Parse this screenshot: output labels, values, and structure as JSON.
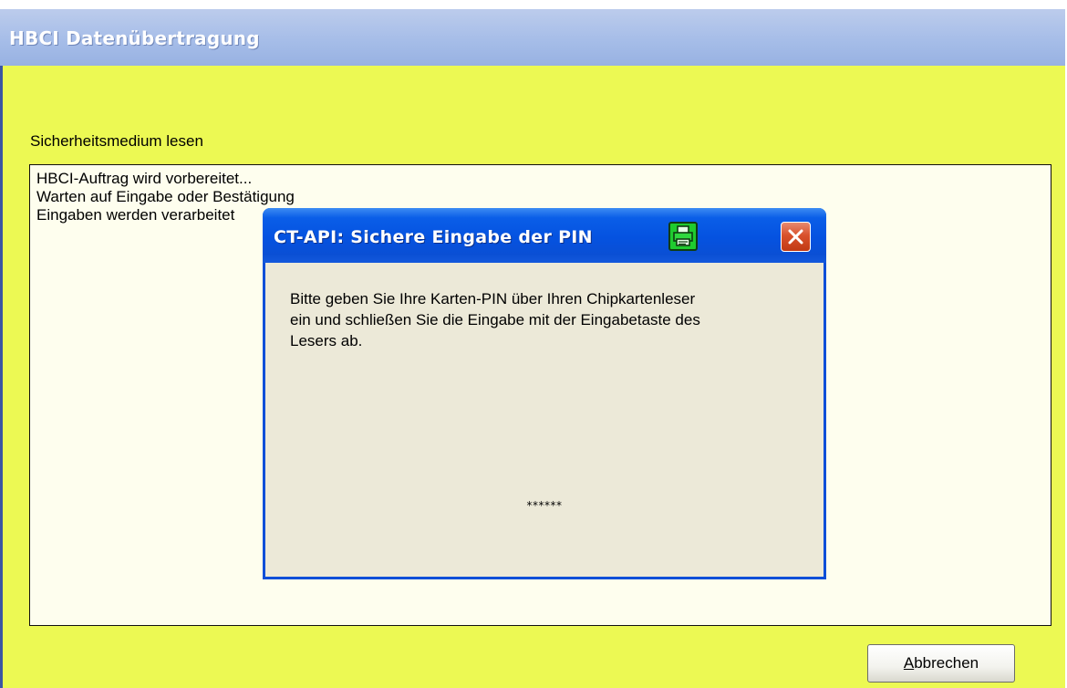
{
  "main_window": {
    "title": "HBCI Datenübertragung",
    "status_label": "Sicherheitsmedium lesen",
    "log_lines": [
      "HBCI-Auftrag wird vorbereitet...",
      "Warten auf Eingabe oder Bestätigung",
      "Eingaben werden verarbeitet"
    ],
    "cancel_button": {
      "accesskey": "A",
      "rest": "bbrechen"
    }
  },
  "pin_dialog": {
    "title": "CT-API: Sichere Eingabe der PIN",
    "message_lines": [
      "Bitte geben Sie Ihre Karten-PIN über Ihren Chipkartenleser",
      "ein und schließen Sie die Eingabe mit der Eingabetaste des",
      "Lesers ab."
    ],
    "pin_mask": "******",
    "icons": {
      "printer": "printer-icon",
      "close": "close-icon"
    }
  },
  "colors": {
    "window_background": "#ecf953",
    "titlebar_inactive": "#a6bde8",
    "dialog_titlebar": "#0552e0",
    "dialog_background": "#ece9d8",
    "log_background": "#fefeee",
    "close_button": "#d9512c",
    "printer_icon": "#1fcb2f"
  }
}
